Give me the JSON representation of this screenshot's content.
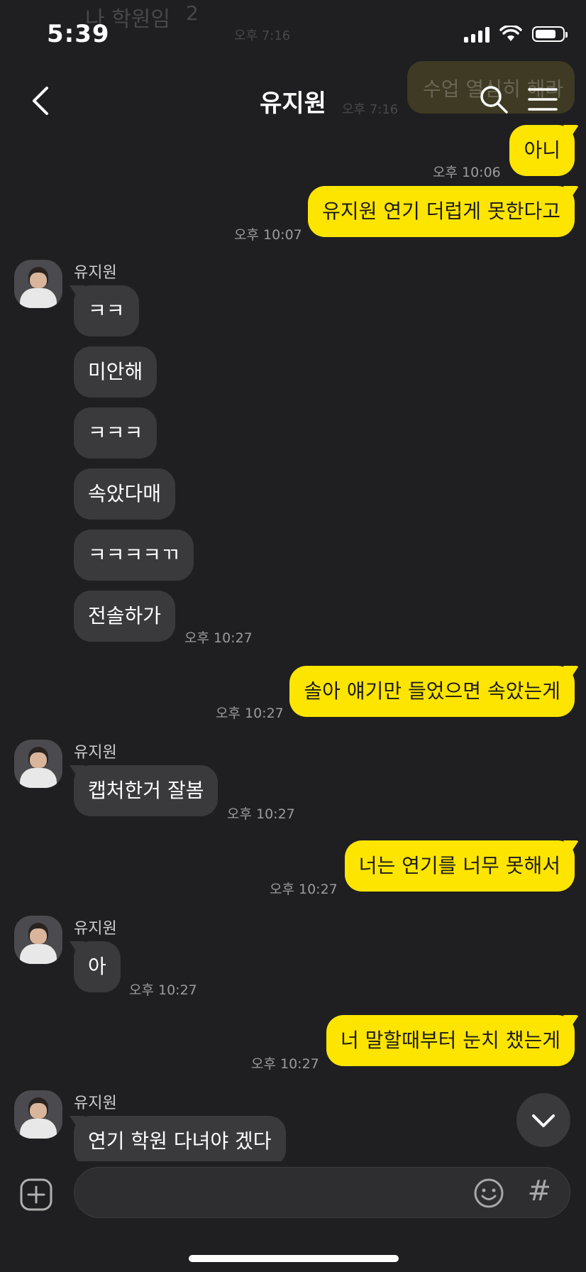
{
  "status": {
    "time": "5:39"
  },
  "background_preview": {
    "name": "나 학원임",
    "badge": "2",
    "time_top": "오후 7:16",
    "message": "수업 열심히 해라",
    "time_side": "오후 7:16"
  },
  "header": {
    "title": "유지원"
  },
  "messages": [
    {
      "from": "me",
      "text": "아니",
      "time": "오후 10:06"
    },
    {
      "from": "me",
      "text": "유지원 연기 더럽게 못한다고",
      "time": "오후 10:07"
    },
    {
      "from": "them",
      "name": "유지원",
      "text": "ㅋㅋ"
    },
    {
      "from": "them",
      "text": "미안해"
    },
    {
      "from": "them",
      "text": "ㅋㅋㅋ"
    },
    {
      "from": "them",
      "text": "속았다매"
    },
    {
      "from": "them",
      "text": "ㅋㅋㅋㅋㄲ"
    },
    {
      "from": "them",
      "text": "전솔하가",
      "time": "오후 10:27"
    },
    {
      "from": "me",
      "text": "솔아 얘기만 들었으면 속았는게",
      "time": "오후 10:27"
    },
    {
      "from": "them",
      "name": "유지원",
      "text": "캡처한거 잘봄",
      "time": "오후 10:27"
    },
    {
      "from": "me",
      "text": "너는 연기를 너무 못해서",
      "time": "오후 10:27"
    },
    {
      "from": "them",
      "name": "유지원",
      "text": "아",
      "time": "오후 10:27"
    },
    {
      "from": "me",
      "text": "너 말할때부터 눈치 챘는게",
      "time": "오후 10:27"
    },
    {
      "from": "them",
      "name": "유지원",
      "text": "연기 학원 다녀야 겠다"
    }
  ],
  "input": {
    "hash_symbol": "#"
  },
  "colors": {
    "my_bubble": "#fee500",
    "their_bubble": "#3a3a3c",
    "background": "#1f1f21"
  }
}
